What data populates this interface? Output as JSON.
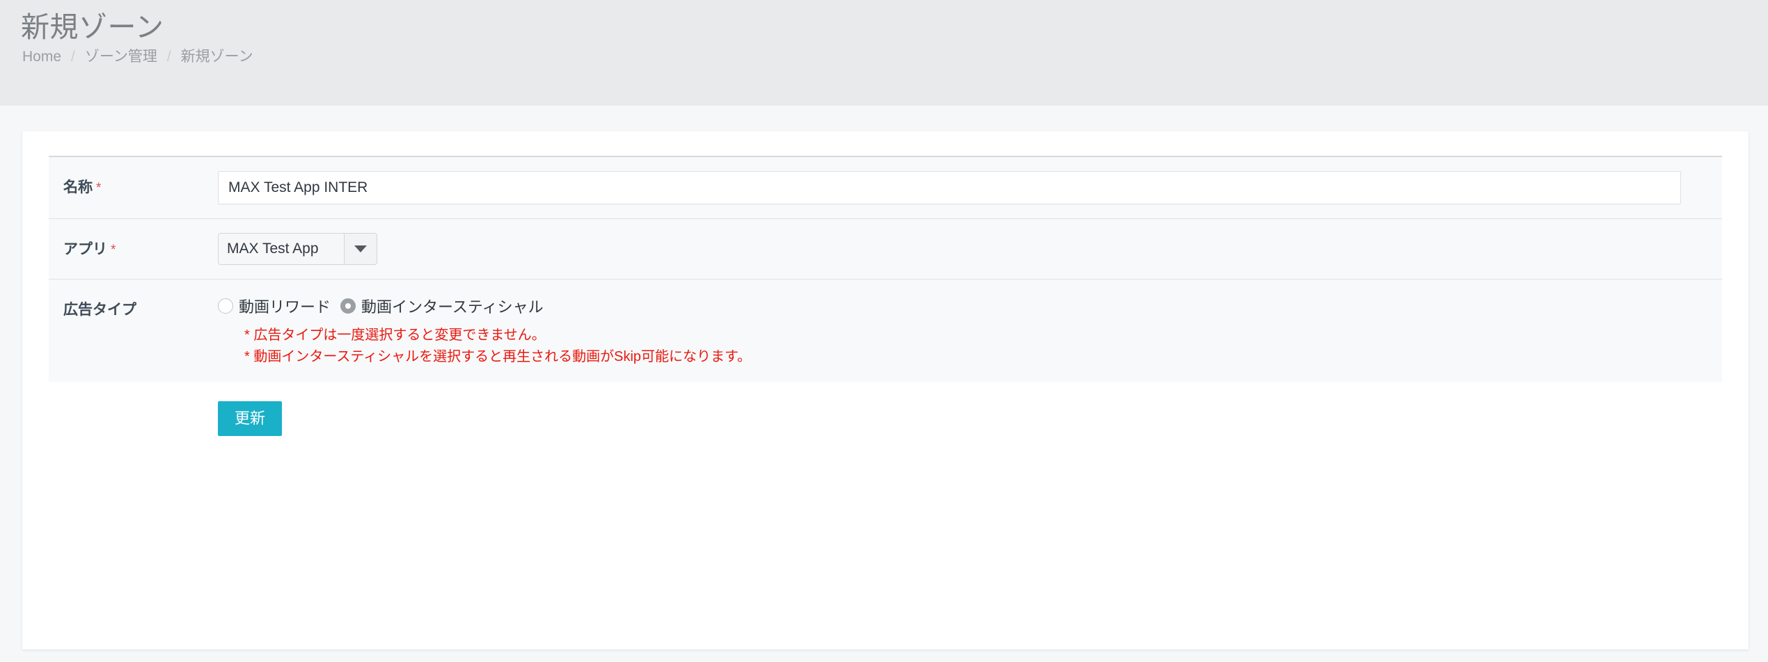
{
  "header": {
    "title": "新規ゾーン",
    "breadcrumb": [
      {
        "label": "Home"
      },
      {
        "label": "ゾーン管理"
      },
      {
        "label": "新規ゾーン"
      }
    ],
    "separator": "/"
  },
  "form": {
    "name_row": {
      "label": "名称",
      "required_mark": "*",
      "value": "MAX Test App INTER",
      "placeholder": ""
    },
    "app_row": {
      "label": "アプリ",
      "required_mark": "*",
      "selected": "MAX Test App",
      "arrow_icon": "chevron-down-icon"
    },
    "adtype_row": {
      "label": "広告タイプ",
      "options": [
        {
          "label": "動画リワード",
          "checked": false
        },
        {
          "label": "動画インタースティシャル",
          "checked": true
        }
      ],
      "notes": [
        "* 広告タイプは一度選択すると変更できません。",
        "* 動画インタースティシャルを選択すると再生される動画がSkip可能になります。"
      ]
    },
    "submit": {
      "label": "更新"
    }
  },
  "colors": {
    "header_band": "#e9eaec",
    "page_bg": "#f6f7f9",
    "card_bg": "#ffffff",
    "panel_bg": "#f8f9fa",
    "required": "#d9534f",
    "note_red": "#e8190f",
    "primary_button": "#1ab0c8"
  }
}
